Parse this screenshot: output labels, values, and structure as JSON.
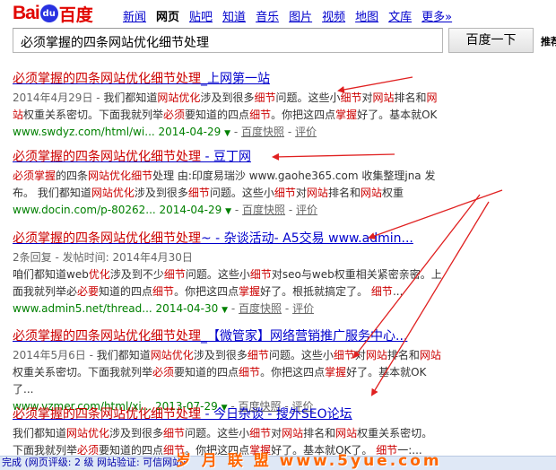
{
  "logo": {
    "bai": "Bai",
    "du": "du",
    "cn": "百度"
  },
  "nav": [
    "新闻",
    "网页",
    "贴吧",
    "知道",
    "音乐",
    "图片",
    "视频",
    "地图",
    "文库",
    "更多»"
  ],
  "nav_current": "网页",
  "search": {
    "query": "必须掌握的四条网站优化细节处理",
    "button": "百度一下",
    "advanced": "推荐"
  },
  "results": [
    {
      "title_hl": "必须掌握的四条网站优化细节处理",
      "title_rest": "_上网第一站",
      "snippet_date": "2014年4月29日 - ",
      "snippet": "我们都知道网站优化涉及到很多细节问题。这些小细节对网站排名和网站权重关系密切。下面我就列举必须要知道的四点细节。你把这四点掌握好了。基本就OK",
      "url": "www.swdyz.com/html/wi...",
      "url_date": "2014-04-29",
      "snapshot": "百度快照",
      "review": "评价"
    },
    {
      "title_hl": "必须掌握的四条网站优化细节处理",
      "title_rest": " - 豆丁网",
      "snippet_date": "",
      "snippet": "必须掌握的四条网站优化细节处理 由:印度易瑞沙 www.gaohe365.com 收集整理jna 发布。 我们都知道网站优化涉及到很多细节问题。这些小细节对网站排名和网站权重",
      "url": "www.docin.com/p-80262...",
      "url_date": "2014-04-29",
      "snapshot": "百度快照",
      "review": "评价"
    },
    {
      "title_hl": "必须掌握的四条网站优化细节处理",
      "title_rest": "~ - 杂谈活动- A5交易 www.admin...",
      "snippet_date": "2条回复 - 发帖时间: 2014年4月30日",
      "snippet": "咱们都知道web优化涉及到不少细节问题。这些小细节对seo与web权重相关紧密亲密。上面我就列举必必要知道的四点细节。你把这四点掌握好了。根抵就搞定了。 细节...",
      "url": "www.admin5.net/thread...",
      "url_date": "2014-04-30",
      "snapshot": "百度快照",
      "review": "评价"
    },
    {
      "title_hl": "必须掌握的四条网站优化细节处理",
      "title_rest": "_【微管家】网络营销推广服务中心...",
      "snippet_date": "2014年5月6日 - ",
      "snippet": "我们都知道网站优化涉及到很多细节问题。这些小细节对网站排名和网站权重关系密切。下面我就列举必须要知道的四点细节。你把这四点掌握好了。基本就OK了...",
      "url": "www.vzmer.com/html/xi...",
      "url_date": "2013-07-29",
      "snapshot": "百度快照",
      "review": "评价"
    },
    {
      "title_hl": "必须掌握的四条网站优化细节处理",
      "title_rest": " - 今日杂谈 - 搜外SEO论坛",
      "snippet_date": "",
      "snippet": "我们都知道网站优化涉及到很多细节问题。这些小细节对网站排名和网站权重关系密切。下面我就列举必须要知道的四点细节。你把这四点掌握好了。基本就OK了。 细节一:...",
      "url": "",
      "url_date": "",
      "snapshot": "",
      "review": ""
    }
  ],
  "status_bar": "完成 (网页评级: 2 级 网站验证: 可信网站)",
  "watermark": "岁 月 联 盟  www.5yue.com",
  "colors": {
    "link": "#0000cc",
    "highlight": "#cc0000",
    "url_green": "#008000",
    "arrow_red": "#e02020",
    "watermark": "#ff6600"
  }
}
